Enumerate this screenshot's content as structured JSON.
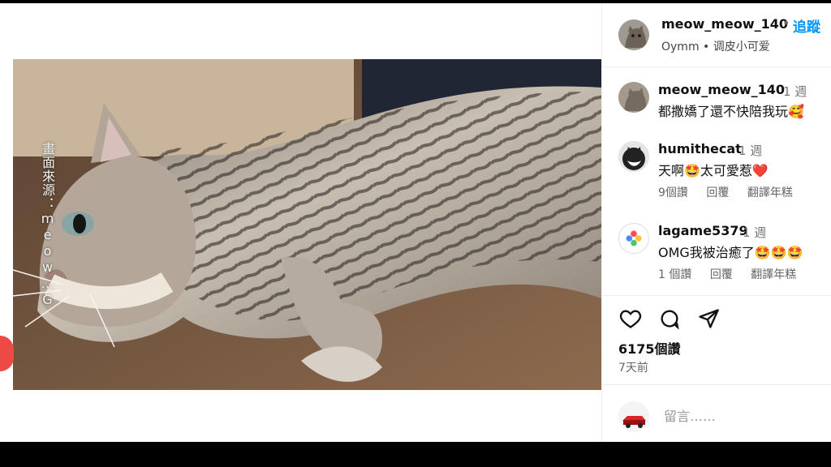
{
  "owner": {
    "username": "meow_meow_140",
    "follow_label": "追蹤",
    "subtitle": "Oymm • 调皮小可爱",
    "avatar_icon": "cat-avatar-icon"
  },
  "video": {
    "watermark": "畫面來源：meow…G",
    "sound_icon": "speaker-icon"
  },
  "comments": [
    {
      "username": "meow_meow_140",
      "time": "1 週",
      "text": "都撒嬌了還不快陪我玩🥰",
      "likes": "",
      "reply": "",
      "translate": "",
      "avatar_icon": "cat-avatar-icon"
    },
    {
      "username": "humithecat",
      "time": "1 週",
      "text": "天啊🤩太可愛惹❤️",
      "likes": "9個讚",
      "reply": "回覆",
      "translate": "翻譯年糕",
      "avatar_icon": "cat-avatar-icon"
    },
    {
      "username": "lagame5379",
      "time": "1 週",
      "text": "OMG我被治癒了🤩🤩🤩",
      "likes": "1 個讚",
      "reply": "回覆",
      "translate": "翻譯年糕",
      "avatar_icon": "flower-avatar-icon"
    }
  ],
  "actions": {
    "likes_count": "6175個讚",
    "posted_time": "7天前",
    "icons": [
      "heart-icon",
      "comment-icon",
      "share-icon"
    ]
  },
  "composer": {
    "placeholder": "留言……",
    "avatar_icon": "car-avatar-icon"
  },
  "colors": {
    "accent": "#0095f6",
    "text": "#111111",
    "muted": "#777777",
    "recording_dot": "#ee4a45"
  }
}
